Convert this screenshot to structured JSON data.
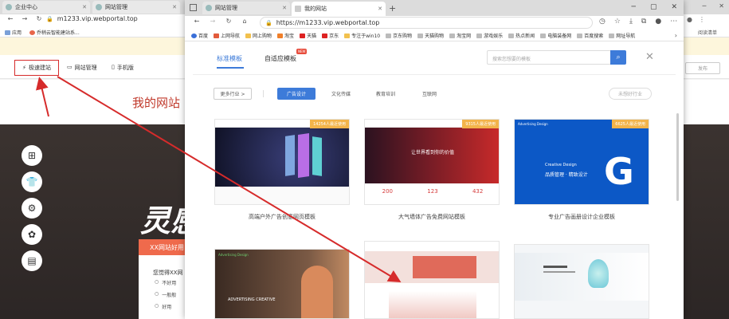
{
  "back_window": {
    "tabs": [
      {
        "title": "企业中心"
      },
      {
        "title": "网站管理"
      }
    ],
    "url": "m1233.vip.webportal.top",
    "bookmarks": {
      "apps": "应用",
      "item1": "乔稍云智能建站系..."
    },
    "toolbar": {
      "quick_build": "极速建站",
      "site_manage": "网站管理",
      "mobile": "手机版"
    },
    "site_title": "我的网站",
    "hero_text": "灵感",
    "survey": {
      "title": "XX网站好用",
      "question": "您觉得XX网",
      "options": [
        "不好用",
        "一般般",
        "好用"
      ]
    },
    "right_reading": "阅读清单",
    "right_btn": "发布"
  },
  "front_window": {
    "tabs": [
      {
        "title": "网站管理"
      },
      {
        "title": "我的网站"
      }
    ],
    "url": "https://m1233.vip.webportal.top",
    "bookmarks": [
      "百度",
      "上网导航",
      "网上购物",
      "淘宝",
      "天猫",
      "京东",
      "专注于win10",
      "京东购物",
      "天猫购物",
      "淘宝网",
      "游戏娱乐",
      "热点新闻",
      "电脑装备网",
      "百度搜索",
      "网址导航"
    ],
    "template_tabs": {
      "standard": "标准模板",
      "adaptive": "自适应模板",
      "new_badge": "NEW"
    },
    "search_placeholder": "搜索您想要的模板",
    "industry_dropdown": "更多行业 >",
    "categories": [
      "广告设计",
      "文化传媒",
      "教育培训",
      "互联网"
    ],
    "unsaved": "未想好行业",
    "cards": [
      {
        "title": "高端户外广告创意网页模板",
        "badge": "14254人最近使用"
      },
      {
        "title": "大气墙体广告免费网站模板",
        "badge": "9315人最近使用"
      },
      {
        "title": "专业广告画册设计企业模板",
        "badge": "6625人最近使用"
      },
      {
        "title": "",
        "badge": ""
      },
      {
        "title": "",
        "badge": ""
      },
      {
        "title": "",
        "badge": ""
      }
    ],
    "card2_text": {
      "headline": "让世界看到你的价值",
      "stats": [
        "200",
        "123",
        "432"
      ]
    },
    "card3_text": {
      "label": "Advertising Design",
      "line1": "Creative Design",
      "line2": "品质管理 · 精致设计"
    },
    "card4_text": {
      "label": "Advertising Design",
      "line": "ADVERTISING CREATIVE"
    }
  },
  "colors": {
    "accent": "#3d7bd9",
    "arrow": "#d62b2b",
    "badge": "#f3b44a"
  }
}
